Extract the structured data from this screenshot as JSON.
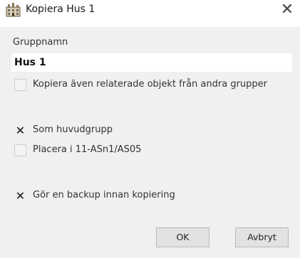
{
  "window": {
    "title": "Kopiera Hus 1",
    "icon": "building-icon",
    "close_symbol": "✕"
  },
  "form": {
    "group_name_label": "Gruppnamn",
    "group_name_value": "Hus 1"
  },
  "options": [
    {
      "label": "Kopiera även relaterade objekt från andra grupper",
      "checked": false
    },
    {
      "label": "Som huvudgrupp",
      "checked": true
    },
    {
      "label": "Placera i 11-ASn1/AS05",
      "checked": false
    },
    {
      "label": "Gör en backup innan kopiering",
      "checked": true
    }
  ],
  "check_symbol": "✕",
  "buttons": {
    "ok_label": "OK",
    "cancel_label": "Avbryt"
  }
}
